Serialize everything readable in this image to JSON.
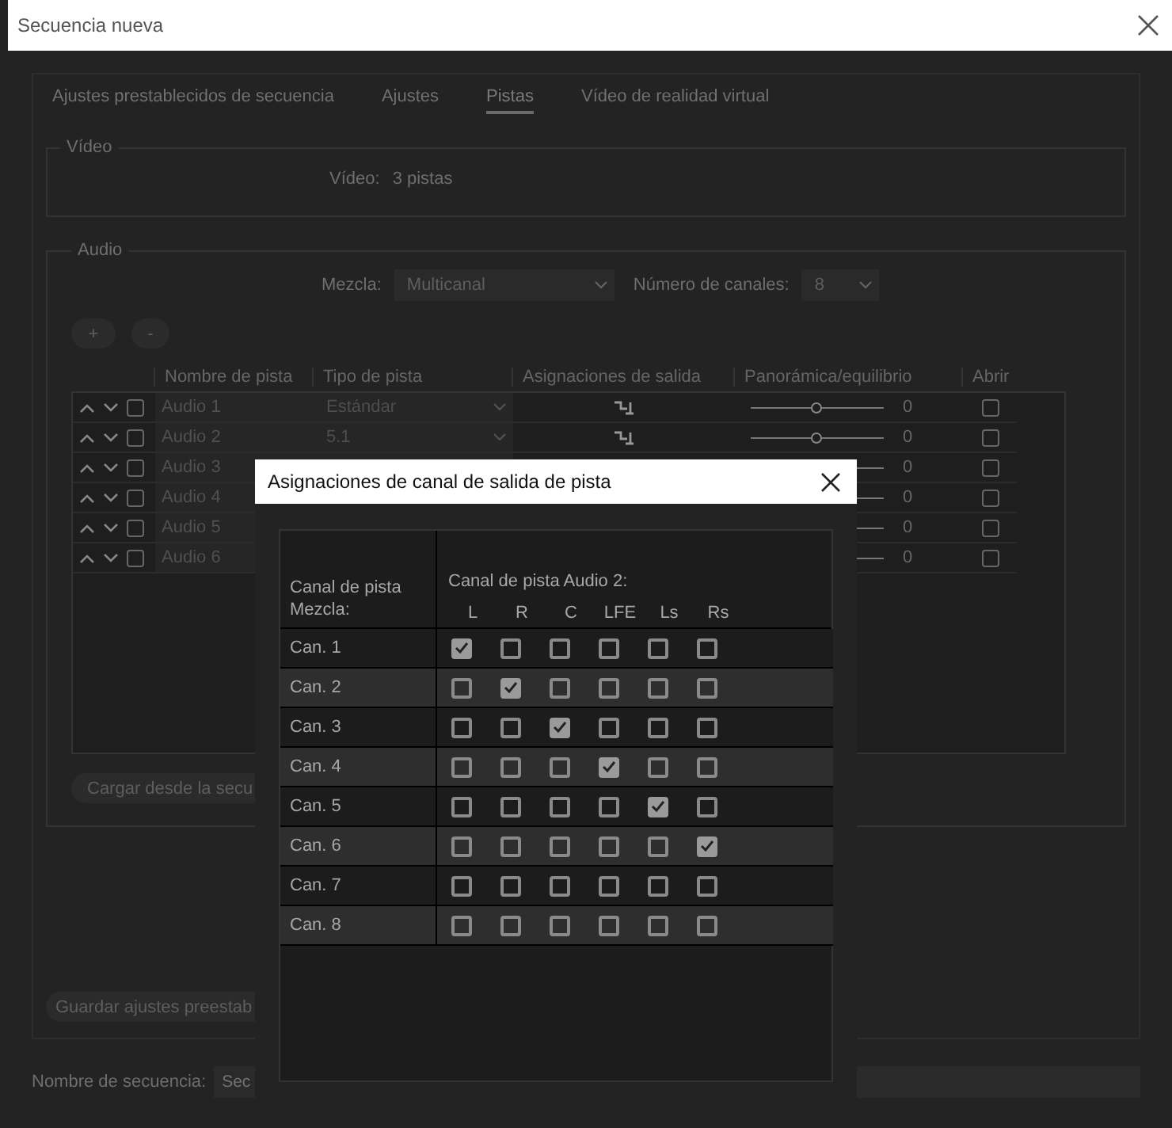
{
  "window": {
    "title": "Secuencia nueva"
  },
  "tabs": [
    {
      "label": "Ajustes prestablecidos de secuencia",
      "selected": false
    },
    {
      "label": "Ajustes",
      "selected": false
    },
    {
      "label": "Pistas",
      "selected": true
    },
    {
      "label": "Vídeo de realidad virtual",
      "selected": false
    }
  ],
  "video_group": {
    "legend": "Vídeo",
    "label": "Vídeo:",
    "value": "3 pistas"
  },
  "audio_group": {
    "legend": "Audio",
    "mix_label": "Mezcla:",
    "mix_value": "Multicanal",
    "channels_label": "Número de canales:",
    "channels_value": "8",
    "add_button": "+",
    "remove_button": "-",
    "columns": [
      "Nombre de pista",
      "Tipo de pista",
      "Asignaciones de salida",
      "Panorámica/equilibrio",
      "Abrir"
    ],
    "tracks": [
      {
        "name": "Audio 1",
        "type": "Estándar",
        "level": 0.5,
        "reading": "0",
        "checked": false,
        "open": false
      },
      {
        "name": "Audio 2",
        "type": "5.1",
        "level": 0.5,
        "reading": "0",
        "checked": false,
        "open": false
      },
      {
        "name": "Audio 3",
        "reading": "0",
        "checked": false,
        "open": false
      },
      {
        "name": "Audio 4",
        "reading": "0",
        "checked": false,
        "open": false
      },
      {
        "name": "Audio 5",
        "reading": "0",
        "checked": false,
        "open": false
      },
      {
        "name": "Audio 6",
        "reading": "0",
        "checked": false,
        "open": false
      }
    ],
    "load_button": "Cargar desde la secu"
  },
  "save_preset_button": "Guardar ajustes preestab",
  "sequence_name": {
    "label": "Nombre de secuencia:",
    "value": "Sec"
  },
  "dialog": {
    "title": "Asignaciones de canal de salida de pista",
    "row_header_lines": [
      "Canal de pista",
      "Mezcla:"
    ],
    "column_header": "Canal de pista Audio 2:",
    "columns": [
      "L",
      "R",
      "C",
      "LFE",
      "Ls",
      "Rs"
    ],
    "rows": [
      {
        "label": "Can. 1",
        "checked": [
          true,
          false,
          false,
          false,
          false,
          false
        ]
      },
      {
        "label": "Can. 2",
        "checked": [
          false,
          true,
          false,
          false,
          false,
          false
        ]
      },
      {
        "label": "Can. 3",
        "checked": [
          false,
          false,
          true,
          false,
          false,
          false
        ]
      },
      {
        "label": "Can. 4",
        "checked": [
          false,
          false,
          false,
          true,
          false,
          false
        ]
      },
      {
        "label": "Can. 5",
        "checked": [
          false,
          false,
          false,
          false,
          true,
          false
        ]
      },
      {
        "label": "Can. 6",
        "checked": [
          false,
          false,
          false,
          false,
          false,
          true
        ]
      },
      {
        "label": "Can. 7",
        "checked": [
          false,
          false,
          false,
          false,
          false,
          false
        ]
      },
      {
        "label": "Can. 8",
        "checked": [
          false,
          false,
          false,
          false,
          false,
          false
        ]
      }
    ]
  }
}
